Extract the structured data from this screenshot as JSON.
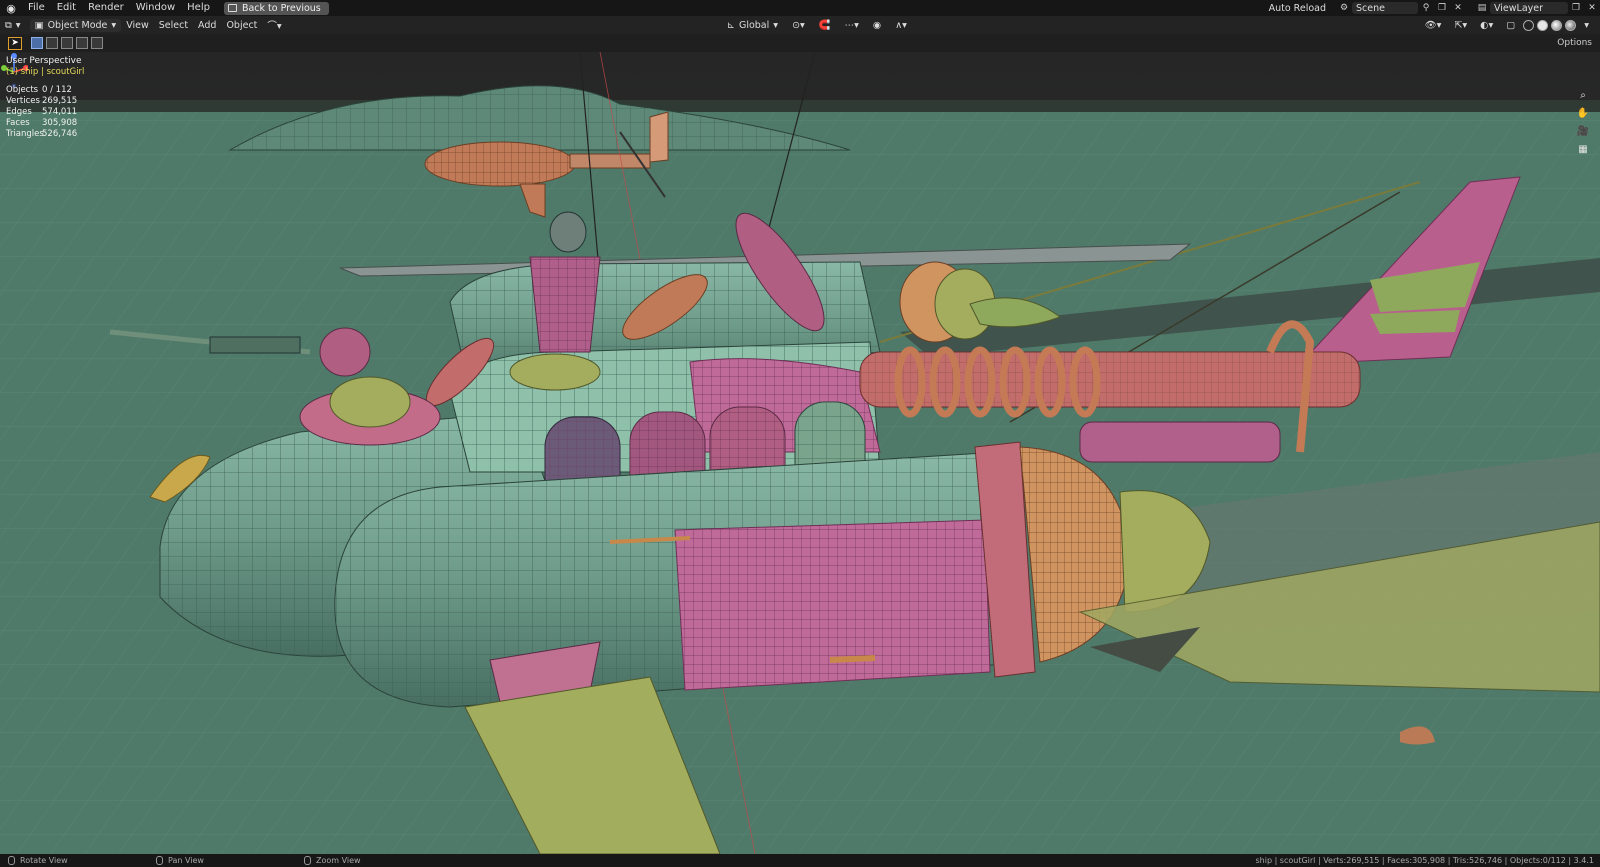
{
  "menubar": {
    "items": [
      "File",
      "Edit",
      "Render",
      "Window",
      "Help"
    ],
    "back_button": "Back to Previous",
    "auto_reload": "Auto Reload",
    "scene": "Scene",
    "view_layer": "ViewLayer"
  },
  "header": {
    "mode": "Object Mode",
    "menus": [
      "View",
      "Select",
      "Add",
      "Object"
    ],
    "transform_orientation": "Global",
    "options": "Options"
  },
  "overlay": {
    "perspective": "User Perspective",
    "object": "(1) ship | scoutGirl",
    "stats": [
      {
        "label": "Objects",
        "value": "0 / 112"
      },
      {
        "label": "Vertices",
        "value": "269,515"
      },
      {
        "label": "Edges",
        "value": "574,011"
      },
      {
        "label": "Faces",
        "value": "305,908"
      },
      {
        "label": "Triangles",
        "value": "526,746"
      }
    ]
  },
  "statusbar": {
    "rotate": "Rotate View",
    "pan": "Pan View",
    "zoom": "Zoom View",
    "info": "ship | scoutGirl | Verts:269,515 | Faces:305,908 | Tris:526,746 | Objects:0/112 | 3.4.1"
  },
  "icons": {
    "blender_logo": "blender-logo-icon",
    "zoom": "zoom-icon",
    "pan": "hand-icon",
    "camera": "camera-icon",
    "grid": "grid-icon"
  },
  "colors": {
    "ground": "#4f7a6a",
    "hull_green": "#6fa08f",
    "hull_pink": "#b05f8c",
    "copper": "#b97a55",
    "olive": "#9a9c4c",
    "wire": "#253a33"
  }
}
